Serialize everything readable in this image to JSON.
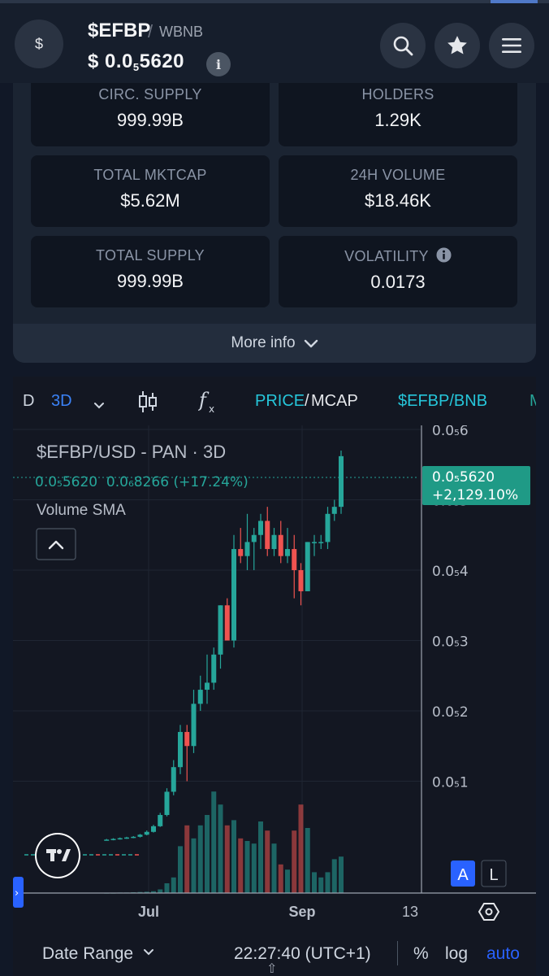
{
  "header": {
    "logo_symbol": "$",
    "token_name": "$EFBP",
    "pair_separator": "/",
    "quote_token": "WBNB",
    "price_prefix": "$ 0.0",
    "price_subscript": "5",
    "price_suffix": "5620",
    "info_glyph": "i",
    "icons": [
      "search-icon",
      "star-icon",
      "menu-icon"
    ]
  },
  "stats": [
    {
      "label": "CIRC. SUPPLY",
      "value": "999.99B"
    },
    {
      "label": "HOLDERS",
      "value": "1.29K"
    },
    {
      "label": "TOTAL MKTCAP",
      "value": "$5.62M"
    },
    {
      "label": "24H VOLUME",
      "value": "$18.46K"
    },
    {
      "label": "TOTAL SUPPLY",
      "value": "999.99B"
    },
    {
      "label": "VOLATILITY",
      "value": "0.0173"
    }
  ],
  "more_info": {
    "label": "More info"
  },
  "toolbar": {
    "timeframe_prev": "D",
    "timeframe_active": "3D",
    "price_label": "PRICE",
    "slash": "/",
    "mcap_label": "MCAP",
    "pair_label": "$EFBP/BNB",
    "overflow_label": "M"
  },
  "legend": {
    "title": "$EFBP/USD - PAN · 3D",
    "ohlc_line": "0.0₅5620  0.0₆8266 (+17.24%)",
    "indicator": "Volume SMA"
  },
  "price_tag": {
    "price": "0.0₅5620",
    "change": "+2,129.10%"
  },
  "scale_buttons": {
    "auto_letter": "A",
    "log_letter": "L"
  },
  "bottom_bar": {
    "date_range": "Date Range",
    "time": "22:27:40 (UTC+1)",
    "percent": "%",
    "log": "log",
    "auto": "auto"
  },
  "colors": {
    "up": "#26a69a",
    "down": "#ef5350",
    "accent": "#2962ff",
    "link": "#26c6da"
  },
  "chart_data": {
    "type": "candlestick",
    "title": "$EFBP/USD - PAN · 3D",
    "x_tick_labels": [
      "Jul",
      "Sep",
      "13"
    ],
    "y_tick_labels": [
      "0.0₅6",
      "0.0₅5",
      "0.0₅4",
      "0.0₅3",
      "0.0₅2",
      "0.0₅1"
    ],
    "ylim": [
      0,
      6.4e-06
    ],
    "grid": true,
    "candles": [
      {
        "o": 1.6e-07,
        "h": 1.8e-07,
        "l": 1.6e-07,
        "c": 1.7e-07,
        "v": 0.002
      },
      {
        "o": 1.7e-07,
        "h": 1.9e-07,
        "l": 1.6e-07,
        "c": 1.8e-07,
        "v": 0.002
      },
      {
        "o": 1.8e-07,
        "h": 2e-07,
        "l": 1.7e-07,
        "c": 1.9e-07,
        "v": 0.004
      },
      {
        "o": 1.9e-07,
        "h": 2.1e-07,
        "l": 1.8e-07,
        "c": 2e-07,
        "v": 0.004
      },
      {
        "o": 2e-07,
        "h": 2.2e-07,
        "l": 1.9e-07,
        "c": 2.1e-07,
        "v": 0.006
      },
      {
        "o": 2.1e-07,
        "h": 2.5e-07,
        "l": 2e-07,
        "c": 2.4e-07,
        "v": 0.008
      },
      {
        "o": 2.4e-07,
        "h": 3e-07,
        "l": 2.3e-07,
        "c": 2.8e-07,
        "v": 0.01
      },
      {
        "o": 2.8e-07,
        "h": 3.8e-07,
        "l": 2.7e-07,
        "c": 3.6e-07,
        "v": 0.014
      },
      {
        "o": 3.6e-07,
        "h": 5.5e-07,
        "l": 3.5e-07,
        "c": 5.2e-07,
        "v": 0.028
      },
      {
        "o": 5.2e-07,
        "h": 9e-07,
        "l": 5e-07,
        "c": 8.5e-07,
        "v": 0.075
      },
      {
        "o": 8.5e-07,
        "h": 1.3e-06,
        "l": 8e-07,
        "c": 1.2e-06,
        "v": 0.12
      },
      {
        "o": 1.2e-06,
        "h": 1.8e-06,
        "l": 1.1e-06,
        "c": 1.7e-06,
        "v": 0.36
      },
      {
        "o": 1.7e-06,
        "h": 1.8e-06,
        "l": 1e-06,
        "c": 1.5e-06,
        "v": 0.52
      },
      {
        "o": 1.5e-06,
        "h": 2.3e-06,
        "l": 1.4e-06,
        "c": 2.1e-06,
        "v": 0.42
      },
      {
        "o": 2.1e-06,
        "h": 2.5e-06,
        "l": 2e-06,
        "c": 2.3e-06,
        "v": 0.52
      },
      {
        "o": 2.3e-06,
        "h": 2.8e-06,
        "l": 2.1e-06,
        "c": 2.4e-06,
        "v": 0.6
      },
      {
        "o": 2.4e-06,
        "h": 2.9e-06,
        "l": 2.3e-06,
        "c": 2.8e-06,
        "v": 0.78
      },
      {
        "o": 2.8e-06,
        "h": 3.5e-06,
        "l": 2.6e-06,
        "c": 3.5e-06,
        "v": 0.68
      },
      {
        "o": 3.5e-06,
        "h": 3.6e-06,
        "l": 3e-06,
        "c": 3e-06,
        "v": 0.52
      },
      {
        "o": 3e-06,
        "h": 4.5e-06,
        "l": 2.9e-06,
        "c": 4.3e-06,
        "v": 0.56
      },
      {
        "o": 4.3e-06,
        "h": 4.6e-06,
        "l": 4.1e-06,
        "c": 4.2e-06,
        "v": 0.42
      },
      {
        "o": 4.2e-06,
        "h": 4.8e-06,
        "l": 4e-06,
        "c": 4.4e-06,
        "v": 0.4
      },
      {
        "o": 4.4e-06,
        "h": 4.6e-06,
        "l": 4e-06,
        "c": 4.5e-06,
        "v": 0.38
      },
      {
        "o": 4.5e-06,
        "h": 4.8e-06,
        "l": 4.3e-06,
        "c": 4.7e-06,
        "v": 0.55
      },
      {
        "o": 4.7e-06,
        "h": 4.9e-06,
        "l": 4.2e-06,
        "c": 4.3e-06,
        "v": 0.48
      },
      {
        "o": 4.3e-06,
        "h": 4.6e-06,
        "l": 4.2e-06,
        "c": 4.5e-06,
        "v": 0.38
      },
      {
        "o": 4.5e-06,
        "h": 4.7e-06,
        "l": 4.1e-06,
        "c": 4.2e-06,
        "v": 0.22
      },
      {
        "o": 4.2e-06,
        "h": 4.6e-06,
        "l": 4.1e-06,
        "c": 4.3e-06,
        "v": 0.18
      },
      {
        "o": 4.3e-06,
        "h": 4.5e-06,
        "l": 3.6e-06,
        "c": 4e-06,
        "v": 0.48
      },
      {
        "o": 4e-06,
        "h": 4.1e-06,
        "l": 3.5e-06,
        "c": 3.7e-06,
        "v": 0.68
      },
      {
        "o": 3.7e-06,
        "h": 4.4e-06,
        "l": 3.7e-06,
        "c": 4.4e-06,
        "v": 0.5
      },
      {
        "o": 4.4e-06,
        "h": 4.5e-06,
        "l": 4.2e-06,
        "c": 4.4e-06,
        "v": 0.16
      },
      {
        "o": 4.4e-06,
        "h": 4.5e-06,
        "l": 4.3e-06,
        "c": 4.4e-06,
        "v": 0.12
      },
      {
        "o": 4.4e-06,
        "h": 4.9e-06,
        "l": 4.3e-06,
        "c": 4.8e-06,
        "v": 0.16
      },
      {
        "o": 4.8e-06,
        "h": 5e-06,
        "l": 4.7e-06,
        "c": 4.9e-06,
        "v": 0.26
      },
      {
        "o": 4.9e-06,
        "h": 5.7e-06,
        "l": 4.8e-06,
        "c": 5.62e-06,
        "v": 0.28
      }
    ]
  }
}
